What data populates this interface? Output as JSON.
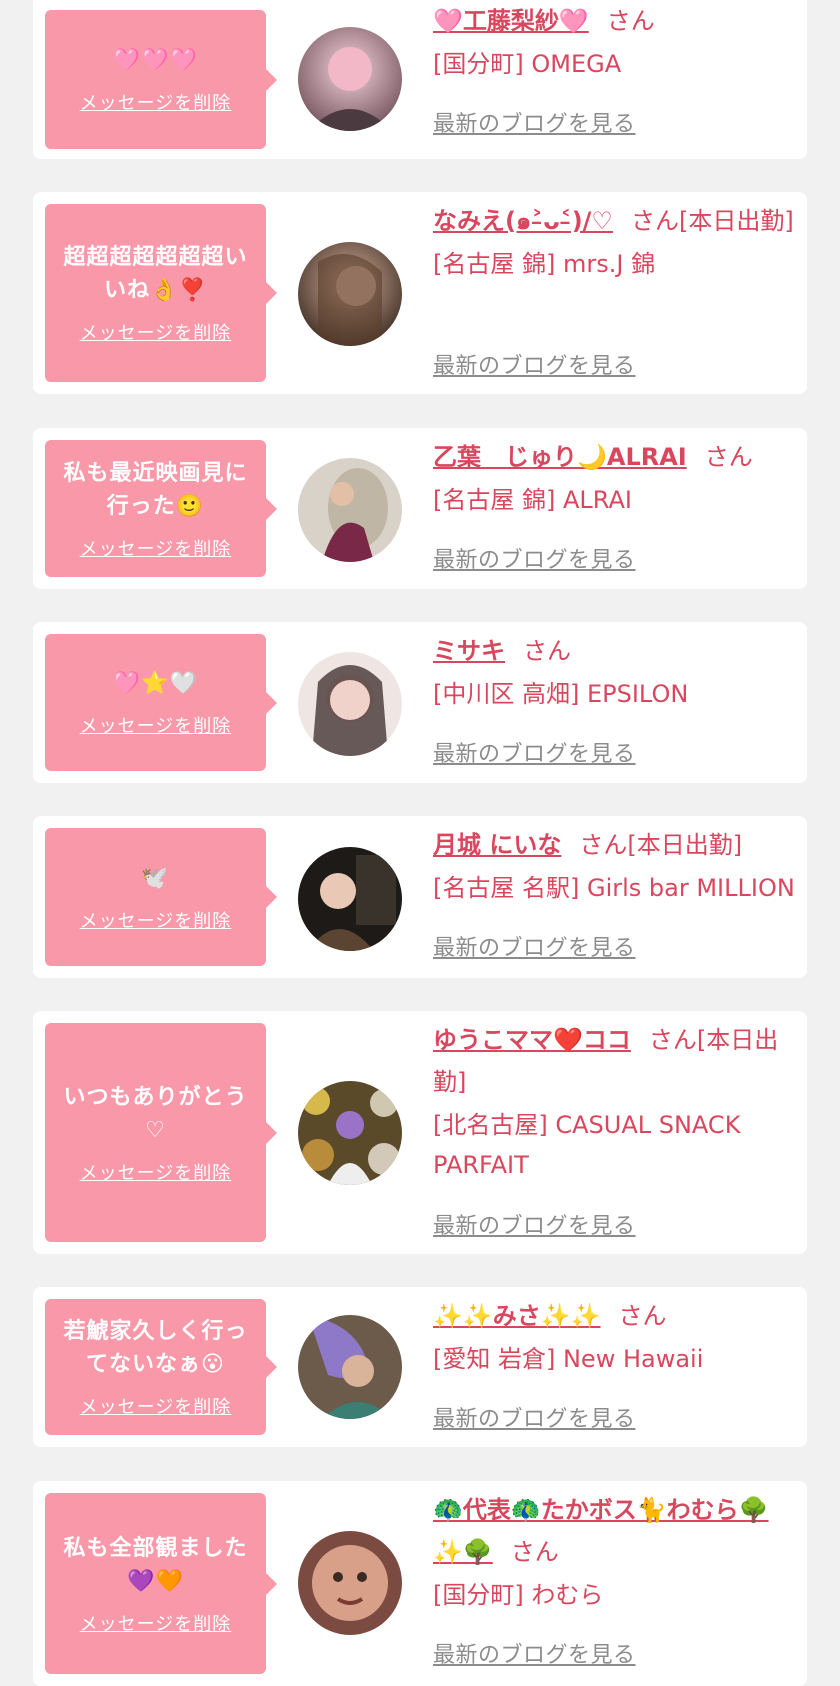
{
  "delete_label": "メッセージを削除",
  "blog_label": "最新のブログを見る",
  "colors": {
    "background": "#f1f1f1",
    "card": "#ffffff",
    "bubble": "#f998a9",
    "accent": "#d9475e",
    "link_gray": "#8c8c8c"
  },
  "items": [
    {
      "message": "🩷🩷🩷",
      "name": "🩷工藤梨紗🩷",
      "suffix": "さん",
      "shop": "[国分町] OMEGA",
      "avatar_icon": "profile-photo"
    },
    {
      "message": "超超超超超超超いいね👌❣️",
      "name": "なみえ(๑˃̵ᴗ˂̵)/♡",
      "suffix": "さん[本日出勤]",
      "shop": "[名古屋 錦] mrs.J 錦",
      "avatar_icon": "profile-photo"
    },
    {
      "message": "私も最近映画見に行った🙂",
      "name": "乙葉　じゅり🌙ALRAI",
      "suffix": "さん",
      "shop": "[名古屋 錦] ALRAI",
      "avatar_icon": "profile-photo"
    },
    {
      "message": "🩷⭐🤍",
      "name": "ミサキ",
      "suffix": "さん",
      "shop": "[中川区 高畑] EPSILON",
      "avatar_icon": "profile-photo"
    },
    {
      "message": "🕊️",
      "name": "月城 にいな",
      "suffix": "さん[本日出勤]",
      "shop": "[名古屋 名駅] Girls bar MILLION",
      "avatar_icon": "profile-photo"
    },
    {
      "message": "いつもありがとう♡",
      "name": "ゆうこママ❤️ココ",
      "suffix": "さん[本日出勤]",
      "shop": "[北名古屋] CASUAL SNACK PARFAIT",
      "avatar_icon": "profile-photo"
    },
    {
      "message": "若鯱家久しく行ってないなぁ😮",
      "name": "✨✨みさ✨✨",
      "suffix": "さん",
      "shop": "[愛知 岩倉] New Hawaii",
      "avatar_icon": "profile-photo"
    },
    {
      "message": "私も全部観ました💜🧡",
      "name": "🦚代表🦚たかボス🐈わむら🌳✨🌳",
      "suffix": "さん",
      "shop": "[国分町] わむら",
      "avatar_icon": "profile-photo"
    }
  ]
}
